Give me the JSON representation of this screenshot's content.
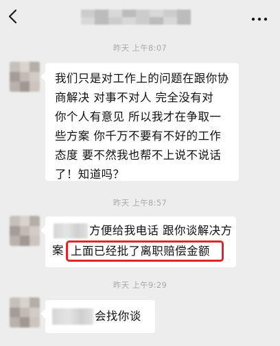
{
  "messages": [
    {
      "timestamp": "昨天 上午8:07",
      "lines": [
        "我们只是对工作上的问题在跟你协",
        "商解决   对事不对人   完全没有对",
        "你个人有意见   所以我才在争取一",
        "些方案   你千万不要有不好的工作",
        "态度   要不然我也帮不上说不说话",
        "了！知道吗？"
      ]
    },
    {
      "timestamp": "昨天 上午8:57",
      "line1_visible": "方便给我电话   跟你谈解决方",
      "line2_prefix": "案",
      "highlighted": "上面已经批了离职赔偿金额"
    },
    {
      "timestamp": "昨天 上午9:29",
      "visible_text": "会找你谈"
    }
  ],
  "icons": {
    "back": "chevron-left-icon",
    "more": "more-horizontal-icon"
  },
  "colors": {
    "background": "#ededed",
    "bubble": "#ffffff",
    "highlight": "#e12424",
    "timestamp": "#a8a8a8"
  }
}
